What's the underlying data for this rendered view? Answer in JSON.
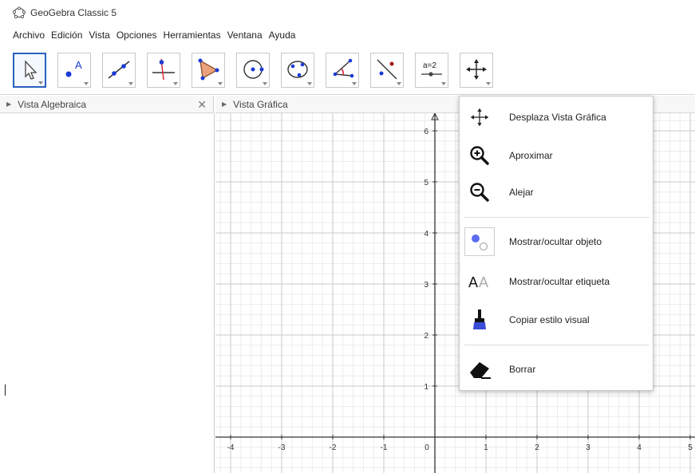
{
  "window": {
    "title": "GeoGebra Classic 5",
    "logo_icon": "geogebra-logo-icon"
  },
  "menu": [
    "Archivo",
    "Edición",
    "Vista",
    "Opciones",
    "Herramientas",
    "Ventana",
    "Ayuda"
  ],
  "toolbar": {
    "tools": [
      {
        "icon": "move-arrow-icon",
        "selected": true
      },
      {
        "icon": "point-icon"
      },
      {
        "icon": "line-icon"
      },
      {
        "icon": "perpendicular-line-icon"
      },
      {
        "icon": "polygon-icon"
      },
      {
        "icon": "circle-center-point-icon"
      },
      {
        "icon": "conic-icon"
      },
      {
        "icon": "angle-icon"
      },
      {
        "icon": "reflect-icon"
      },
      {
        "icon": "slider-icon",
        "text": "a=2"
      },
      {
        "icon": "move-graphics-view-icon"
      }
    ]
  },
  "algebra_view": {
    "title": "Vista Algebraica",
    "close_icon": "close-icon"
  },
  "graphics_view": {
    "title": "Vista Gráfica",
    "x_ticks": [
      "-4",
      "-3",
      "-2",
      "-1",
      "0",
      "1",
      "2",
      "3",
      "4",
      "5"
    ],
    "y_ticks": [
      "1",
      "2",
      "3",
      "4",
      "5",
      "6"
    ]
  },
  "popup_menu": {
    "items": [
      {
        "label": "Desplaza Vista Gráfica",
        "icon": "move-graphics-view-icon"
      },
      {
        "label": "Aproximar",
        "icon": "zoom-in-icon"
      },
      {
        "label": "Alejar",
        "icon": "zoom-out-icon"
      },
      {
        "label": "Mostrar/ocultar objeto",
        "icon": "show-hide-object-icon"
      },
      {
        "label": "Mostrar/ocultar etiqueta",
        "icon": "show-hide-label-icon"
      },
      {
        "label": "Copiar estilo visual",
        "icon": "copy-visual-style-icon"
      },
      {
        "label": "Borrar",
        "icon": "eraser-icon"
      }
    ]
  },
  "colors": {
    "selected_border": "#2a5fbf",
    "accent_blue": "#1a3ad6",
    "grid_major": "#c8c8c8",
    "grid_minor": "#ececec"
  }
}
